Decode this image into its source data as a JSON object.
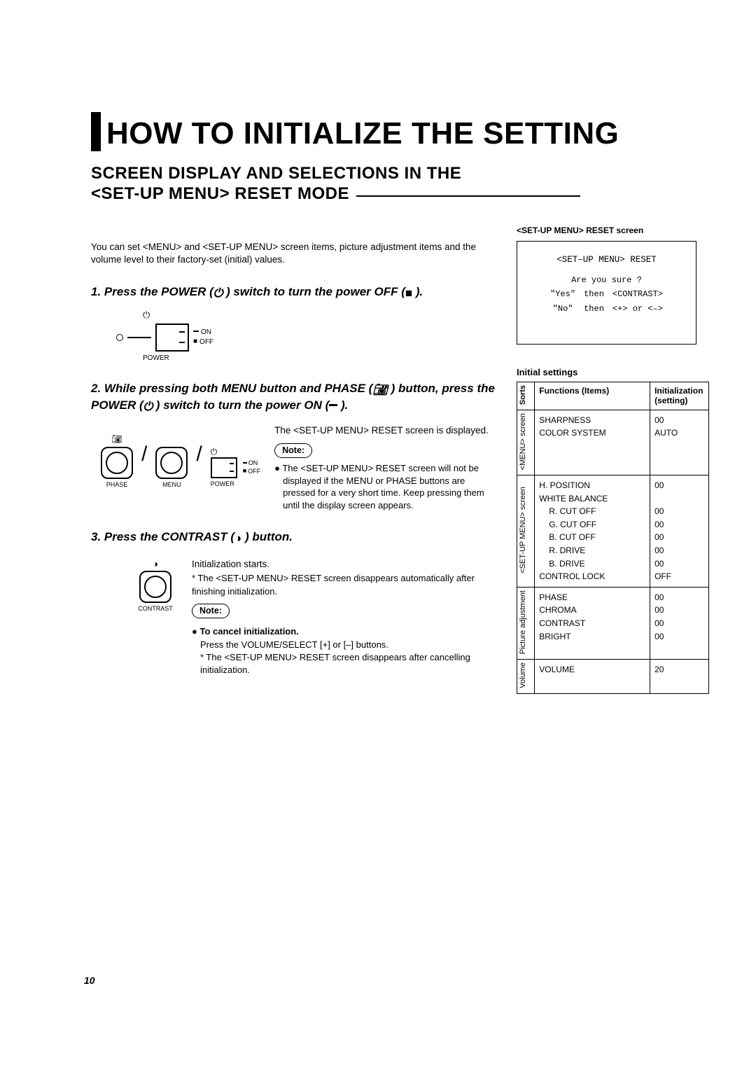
{
  "title": "HOW TO INITIALIZE THE SETTING",
  "subtitle_line1": "SCREEN DISPLAY AND SELECTIONS IN THE",
  "subtitle_line2": "<SET-UP MENU> RESET MODE",
  "intro": "You can set <MENU> and <SET-UP MENU> screen items, picture adjustment items and the volume level to their factory-set (initial) values.",
  "steps": {
    "s1": {
      "title_a": "1. Press the POWER (",
      "title_b": " ) switch to turn the power OFF (",
      "title_c": " )."
    },
    "s2": {
      "title_a": "2. While pressing both MENU button and PHASE (",
      "title_b": " ) button, press the POWER (",
      "title_c": " ) switch to turn the power ON (",
      "title_d": " ).",
      "body1": "The <SET-UP MENU> RESET screen is displayed.",
      "note_body": "● The <SET-UP MENU> RESET screen will not be displayed if the MENU or PHASE buttons are pressed for a very short time. Keep pressing them until the display screen appears."
    },
    "s3": {
      "title_a": "3. Press the CONTRAST (",
      "title_b": " ) button.",
      "body1": "Initialization starts.",
      "body2": "* The <SET-UP MENU> RESET screen disappears automatically after finishing initialization.",
      "cancel_head": "● To cancel initialization.",
      "cancel_body1": "Press the VOLUME/SELECT [+] or [–] buttons.",
      "cancel_body2": "* The <SET-UP MENU> RESET screen disappears after cancelling initialization."
    }
  },
  "labels": {
    "on": "ON",
    "off": "OFF",
    "power": "POWER",
    "phase": "PHASE",
    "menu": "MENU",
    "contrast": "CONTRAST",
    "note": "Note:"
  },
  "reset_screen": {
    "caption": "<SET-UP MENU>  RESET screen",
    "line1": "<SET–UP MENU> RESET",
    "q": "Are   you    sure ?",
    "yes_l": "\"Yes\"",
    "yes_m": "then",
    "yes_r": "<CONTRAST>",
    "no_l": "\"No\"",
    "no_m": "then",
    "no_r": "<+>   or   <–>"
  },
  "initial_settings": {
    "caption": "Initial settings",
    "header_sorts": "Sorts",
    "header_func": "Functions (Items)",
    "header_init": "Initialization (setting)",
    "rows": {
      "menu": {
        "sort": "<MENU> screen",
        "func": "SHARPNESS\nCOLOR SYSTEM",
        "val": "00\nAUTO"
      },
      "setup": {
        "sort": "<SET-UP MENU> screen",
        "func_lines": [
          "H. POSITION",
          "WHITE BALANCE",
          "R. CUT OFF",
          "G. CUT OFF",
          "B. CUT OFF",
          "R. DRIVE",
          "B. DRIVE",
          "CONTROL LOCK"
        ],
        "val_lines": [
          "00",
          "",
          "00",
          "00",
          "00",
          "00",
          "00",
          "OFF"
        ]
      },
      "picture": {
        "sort": "Picture adjustment",
        "func": "PHASE\nCHROMA\nCONTRAST\nBRIGHT",
        "val": "00\n00\n00\n00"
      },
      "volume": {
        "sort": "Volume",
        "func": "VOLUME",
        "val": "20"
      }
    }
  },
  "page_number": "10"
}
